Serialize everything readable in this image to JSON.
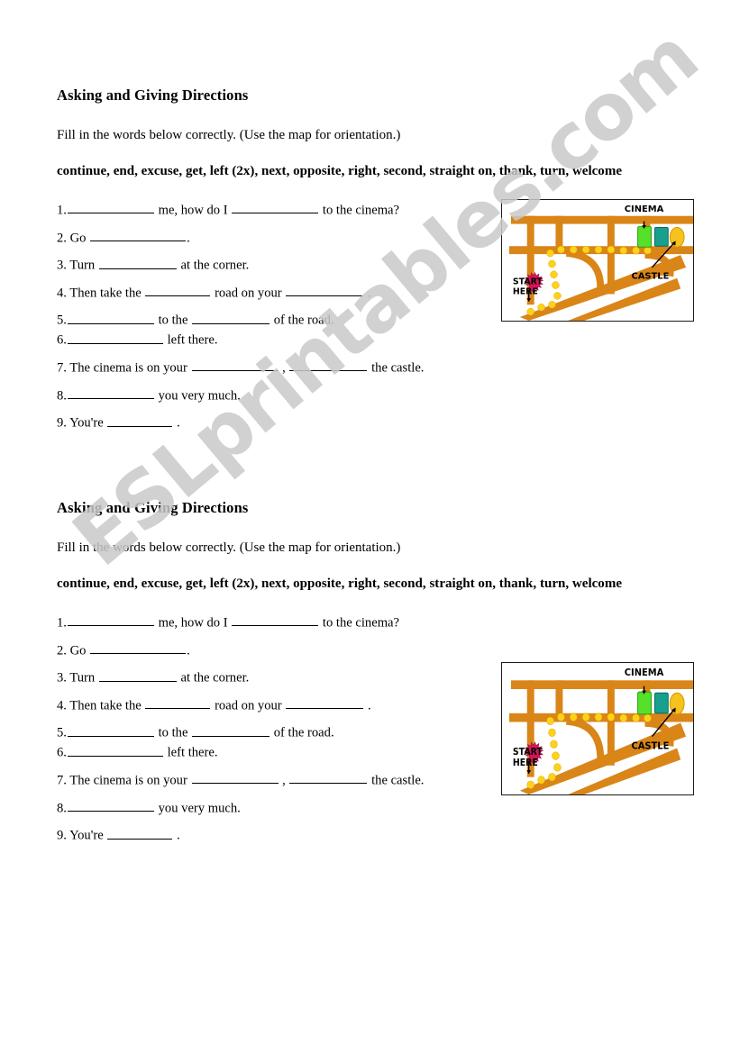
{
  "document": {
    "type": "esl-worksheet",
    "page_background": "#ffffff",
    "watermark": {
      "text": "ESLprintables.com",
      "color": "#c9c9c9",
      "rotation_deg": -40
    }
  },
  "sections": [
    {
      "id": "section-1",
      "title": "Asking and Giving Directions",
      "instruction": "Fill in the words below correctly. (Use the map for orientation.)",
      "word_bank": "continue, end, excuse, get, left (2x), next, opposite, right, second, straight on, thank, turn, welcome",
      "questions": [
        {
          "number": "1.",
          "parts": [
            "",
            " me, how do I ",
            " to the cinema?"
          ]
        },
        {
          "number": "2.",
          "parts": [
            "Go ",
            "."
          ]
        },
        {
          "number": "3.",
          "parts": [
            "Turn ",
            " at the corner."
          ]
        },
        {
          "number": "4.",
          "parts": [
            "Then take the ",
            " road on your ",
            " ."
          ]
        },
        {
          "number": "5.",
          "parts": [
            "",
            " to the ",
            " of the road."
          ]
        },
        {
          "number": "6.",
          "parts": [
            "",
            " left there."
          ]
        },
        {
          "number": "7.",
          "parts": [
            "The cinema is on your ",
            " , ",
            " the castle."
          ]
        },
        {
          "number": "8.",
          "parts": [
            "",
            " you very much."
          ]
        },
        {
          "number": "9.",
          "parts": [
            "You're ",
            " ."
          ]
        }
      ]
    },
    {
      "id": "section-2",
      "title": "Asking and Giving Directions",
      "instruction": "Fill in the words below correctly. (Use the map for orientation.)",
      "word_bank": "continue, end, excuse, get, left (2x), next, opposite, right, second, straight on, thank, turn, welcome",
      "questions": [
        {
          "number": "1.",
          "parts": [
            "",
            " me, how do I ",
            " to the cinema?"
          ]
        },
        {
          "number": "2.",
          "parts": [
            "Go ",
            "."
          ]
        },
        {
          "number": "3.",
          "parts": [
            "Turn ",
            " at the corner."
          ]
        },
        {
          "number": "4.",
          "parts": [
            "Then take the ",
            " road on your ",
            " ."
          ]
        },
        {
          "number": "5.",
          "parts": [
            "",
            " to the ",
            " of the road."
          ]
        },
        {
          "number": "6.",
          "parts": [
            "",
            " left there."
          ]
        },
        {
          "number": "7.",
          "parts": [
            "The cinema is on your ",
            " , ",
            " the castle."
          ]
        },
        {
          "number": "8.",
          "parts": [
            "",
            " you very much."
          ]
        },
        {
          "number": "9.",
          "parts": [
            "You're ",
            " ."
          ]
        }
      ]
    }
  ],
  "map": {
    "labels": {
      "cinema": "CINEMA",
      "castle": "CASTLE",
      "start_line1": "START",
      "start_line2": "HERE"
    },
    "colors": {
      "road": "#d98518",
      "road_light": "#e9a23c",
      "route_dot": "#ffd21a",
      "cinema_building": "#55e02a",
      "second_building": "#17a08e",
      "castle_marker": "#f5c21e",
      "start_marker": "#d5145a",
      "border": "#1a1a1a",
      "label_text": "#000000"
    }
  }
}
